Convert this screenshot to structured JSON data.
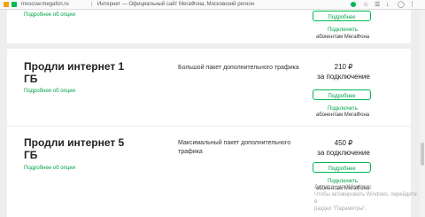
{
  "browser": {
    "url": "moscow.megafon.ru",
    "separator": "|",
    "title": "Интернет — Официальный сайт МегаФона, Московский регион"
  },
  "cards": [
    {
      "title": "",
      "link": "Подробнее об опции",
      "description": "",
      "price": "",
      "price_unit": "",
      "details_button": "Подробнее",
      "connect_link": "Подключить",
      "subscribers": "абонентам МегаФона"
    },
    {
      "title": "Продли интернет 1 ГБ",
      "link": "Подробнее об опции",
      "description": "Большой пакет дополнительного трафика",
      "price": "210 ₽",
      "price_unit": "за подключение",
      "details_button": "Подробнее",
      "connect_link": "Подключить",
      "subscribers": "абонентам МегаФона"
    },
    {
      "title": "Продли интернет 5 ГБ",
      "link": "Подробнее об опции",
      "description": "Максимальный пакет дополнительного трафика",
      "price": "450 ₽",
      "price_unit": "за подключение",
      "details_button": "Подробнее",
      "connect_link": "Подключить",
      "subscribers": "абонентам МегаФона"
    }
  ],
  "watermark": {
    "title": "Активация Windows",
    "line1": "Чтобы активировать Windows, перейдите в",
    "line2": "раздел \"Параметры\"."
  },
  "colors": {
    "accent": "#00b956",
    "page_bg": "#eeeeee",
    "card_bg": "#ffffff"
  }
}
